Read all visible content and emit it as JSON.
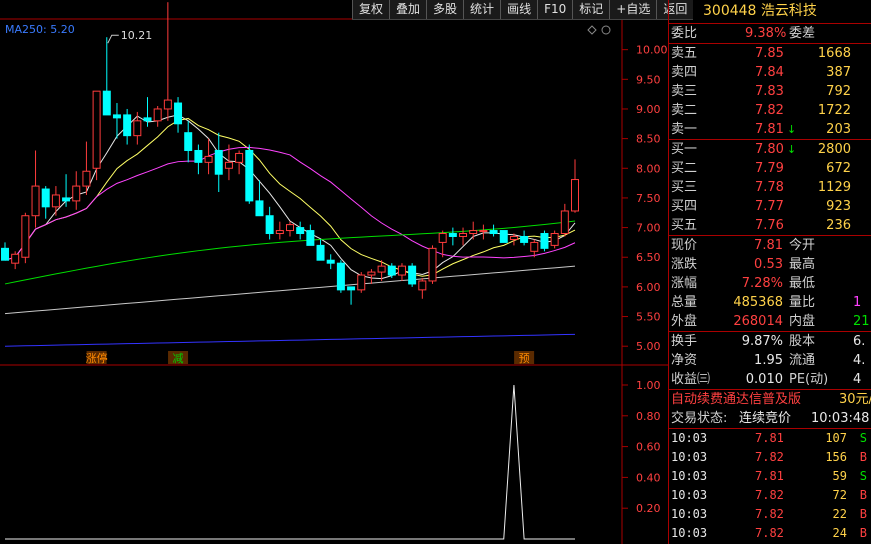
{
  "toolbar": [
    "复权",
    "叠加",
    "多股",
    "统计",
    "画线",
    "F10",
    "标记",
    "+自选",
    "返回"
  ],
  "main_chart": {
    "ma_label": "MA250: 5.20",
    "high_label": "10.21",
    "price_ticks": [
      "10.00",
      "9.50",
      "9.00",
      "8.50",
      "8.00",
      "7.50",
      "7.00",
      "6.50",
      "6.00",
      "5.50",
      "5.00"
    ],
    "markers": [
      "涨停",
      "减",
      "预"
    ]
  },
  "sub_chart": {
    "ticks": [
      "1.00",
      "0.80",
      "0.60",
      "0.40",
      "0.20"
    ]
  },
  "colors": {
    "up": "#ff3c3c",
    "down": "#00ffff",
    "ma5": "#e8e8e8",
    "ma10": "#ffff66",
    "ma20": "#ff44ff",
    "ma60": "#00dd00",
    "ma120": "#c8c8c8",
    "ma250": "#3333ff"
  },
  "chart_data": {
    "type": "candlestick",
    "ylim": [
      4.7,
      10.5
    ],
    "ohlc": [
      [
        6.65,
        6.75,
        6.45,
        6.45
      ],
      [
        6.4,
        6.6,
        6.3,
        6.55
      ],
      [
        6.5,
        7.25,
        6.4,
        7.2
      ],
      [
        7.2,
        8.3,
        7.0,
        7.7
      ],
      [
        7.65,
        7.7,
        7.15,
        7.35
      ],
      [
        7.35,
        7.7,
        7.2,
        7.55
      ],
      [
        7.5,
        7.9,
        7.35,
        7.45
      ],
      [
        7.45,
        7.95,
        7.3,
        7.7
      ],
      [
        7.7,
        8.45,
        7.55,
        7.95
      ],
      [
        8.0,
        9.3,
        7.8,
        9.3
      ],
      [
        9.3,
        10.21,
        9.0,
        8.9
      ],
      [
        8.9,
        9.1,
        8.5,
        8.85
      ],
      [
        8.9,
        9.0,
        8.4,
        8.55
      ],
      [
        8.55,
        8.95,
        8.4,
        8.8
      ],
      [
        8.85,
        9.2,
        8.7,
        8.8
      ],
      [
        8.8,
        9.05,
        8.7,
        9.0
      ],
      [
        9.0,
        10.8,
        8.8,
        9.15
      ],
      [
        9.1,
        9.2,
        8.6,
        8.75
      ],
      [
        8.6,
        8.8,
        8.1,
        8.3
      ],
      [
        8.3,
        8.4,
        7.9,
        8.1
      ],
      [
        8.1,
        8.5,
        7.9,
        8.2
      ],
      [
        8.3,
        8.6,
        7.6,
        7.9
      ],
      [
        8.0,
        8.4,
        7.8,
        8.1
      ],
      [
        8.1,
        8.3,
        7.9,
        8.25
      ],
      [
        8.3,
        8.4,
        7.4,
        7.45
      ],
      [
        7.45,
        7.8,
        7.2,
        7.2
      ],
      [
        7.2,
        7.35,
        6.8,
        6.9
      ],
      [
        6.9,
        7.1,
        6.8,
        6.95
      ],
      [
        6.95,
        7.1,
        6.85,
        7.05
      ],
      [
        7.0,
        7.1,
        6.8,
        6.9
      ],
      [
        6.95,
        7.05,
        6.7,
        6.7
      ],
      [
        6.7,
        6.8,
        6.5,
        6.45
      ],
      [
        6.45,
        6.55,
        6.3,
        6.4
      ],
      [
        6.4,
        6.45,
        5.9,
        5.95
      ],
      [
        6.0,
        6.0,
        5.7,
        5.95
      ],
      [
        5.95,
        6.25,
        5.9,
        6.2
      ],
      [
        6.2,
        6.3,
        6.05,
        6.25
      ],
      [
        6.25,
        6.45,
        6.1,
        6.35
      ],
      [
        6.35,
        6.4,
        6.15,
        6.2
      ],
      [
        6.2,
        6.4,
        6.1,
        6.35
      ],
      [
        6.35,
        6.4,
        6.0,
        6.05
      ],
      [
        5.95,
        6.15,
        5.8,
        6.1
      ],
      [
        6.1,
        6.7,
        6.05,
        6.65
      ],
      [
        6.75,
        6.95,
        6.5,
        6.9
      ],
      [
        6.9,
        7.0,
        6.7,
        6.85
      ],
      [
        6.85,
        7.0,
        6.7,
        6.9
      ],
      [
        6.9,
        7.1,
        6.8,
        6.95
      ],
      [
        6.95,
        7.05,
        6.8,
        6.95
      ],
      [
        6.95,
        7.05,
        6.85,
        6.9
      ],
      [
        6.95,
        6.95,
        6.75,
        6.75
      ],
      [
        6.8,
        6.9,
        6.7,
        6.85
      ],
      [
        6.85,
        6.95,
        6.7,
        6.75
      ],
      [
        6.6,
        6.8,
        6.5,
        6.75
      ],
      [
        6.9,
        6.95,
        6.6,
        6.65
      ],
      [
        6.7,
        6.95,
        6.65,
        6.9
      ],
      [
        6.9,
        7.4,
        6.85,
        7.28
      ],
      [
        7.28,
        8.15,
        7.25,
        7.81
      ]
    ],
    "sub_series": [
      0,
      0,
      0,
      0,
      0,
      0,
      0,
      0,
      0,
      0,
      0,
      0,
      0,
      0,
      0,
      0,
      0,
      0,
      0,
      0,
      0,
      0,
      0,
      0,
      0,
      0,
      0,
      0,
      0,
      0,
      0,
      0,
      0,
      0,
      0,
      0,
      0,
      0,
      0,
      0,
      0,
      0,
      0,
      0,
      0,
      0,
      0,
      0,
      0,
      0,
      1.0,
      0,
      0,
      0,
      0,
      0,
      0
    ]
  },
  "quote": {
    "code": "300448",
    "name": "浩云科技",
    "wb_label": "委比",
    "wb_val": "9.38%",
    "wc_label": "委差",
    "sells": [
      {
        "label": "卖五",
        "price": "7.85",
        "vol": "1668",
        "arrow": ""
      },
      {
        "label": "卖四",
        "price": "7.84",
        "vol": "387",
        "arrow": ""
      },
      {
        "label": "卖三",
        "price": "7.83",
        "vol": "792",
        "arrow": ""
      },
      {
        "label": "卖二",
        "price": "7.82",
        "vol": "1722",
        "arrow": ""
      },
      {
        "label": "卖一",
        "price": "7.81",
        "vol": "203",
        "arrow": "↓"
      }
    ],
    "buys": [
      {
        "label": "买一",
        "price": "7.80",
        "vol": "2800",
        "arrow": "↓"
      },
      {
        "label": "买二",
        "price": "7.79",
        "vol": "672",
        "arrow": ""
      },
      {
        "label": "买三",
        "price": "7.78",
        "vol": "1129",
        "arrow": ""
      },
      {
        "label": "买四",
        "price": "7.77",
        "vol": "923",
        "arrow": ""
      },
      {
        "label": "买五",
        "price": "7.76",
        "vol": "236",
        "arrow": ""
      }
    ],
    "stats": [
      {
        "l1": "现价",
        "v1": "7.81",
        "l2": "今开",
        "v2": ""
      },
      {
        "l1": "涨跌",
        "v1": "0.53",
        "l2": "最高",
        "v2": ""
      },
      {
        "l1": "涨幅",
        "v1": "7.28%",
        "l2": "最低",
        "v2": ""
      },
      {
        "l1": "总量",
        "v1": "485368",
        "l2": "量比",
        "v2": "1"
      },
      {
        "l1": "外盘",
        "v1": "268014",
        "l2": "内盘",
        "v2": "21"
      }
    ],
    "stats2": [
      {
        "l1": "换手",
        "v1": "9.87%",
        "l2": "股本",
        "v2": "6."
      },
      {
        "l1": "净资",
        "v1": "1.95",
        "l2": "流通",
        "v2": "4."
      },
      {
        "l1": "收益㈢",
        "v1": "0.010",
        "l2": "PE(动)",
        "v2": "4"
      }
    ],
    "promo": "自动续费通达信普及版",
    "promo_price": "30元/",
    "status_label": "交易状态:",
    "status_val": "连续竞价",
    "status_time": "10:03:48",
    "ticks": [
      {
        "time": "10:03",
        "price": "7.81",
        "vol": "107",
        "side": "S"
      },
      {
        "time": "10:03",
        "price": "7.82",
        "vol": "156",
        "side": "B"
      },
      {
        "time": "10:03",
        "price": "7.81",
        "vol": "59",
        "side": "S"
      },
      {
        "time": "10:03",
        "price": "7.82",
        "vol": "72",
        "side": "B"
      },
      {
        "time": "10:03",
        "price": "7.82",
        "vol": "22",
        "side": "B"
      },
      {
        "time": "10:03",
        "price": "7.82",
        "vol": "24",
        "side": "B"
      }
    ]
  }
}
